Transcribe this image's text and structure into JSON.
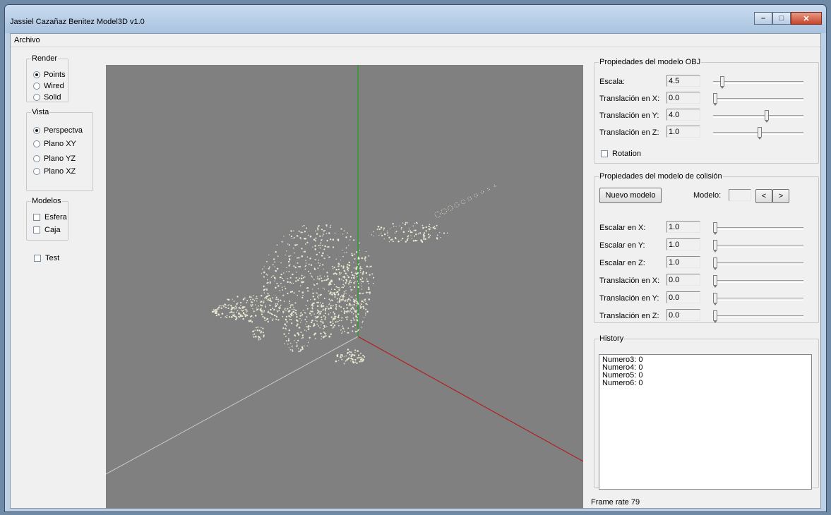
{
  "window": {
    "title": "Jassiel Cazañaz Benitez Model3D v1.0",
    "buttons": {
      "minimize": "–",
      "maximize": "□",
      "close": "✕"
    }
  },
  "menu": {
    "items": [
      "Archivo"
    ]
  },
  "render": {
    "legend": "Render",
    "options": [
      {
        "label": "Points",
        "selected": true
      },
      {
        "label": "Wired",
        "selected": false
      },
      {
        "label": "Solid",
        "selected": false
      }
    ]
  },
  "vista": {
    "legend": "Vista",
    "options": [
      {
        "label": "Perspectva",
        "selected": true
      },
      {
        "label": "Plano XY",
        "selected": false
      },
      {
        "label": "Plano YZ",
        "selected": false
      },
      {
        "label": "Plano XZ",
        "selected": false
      }
    ]
  },
  "modelos": {
    "legend": "Modelos",
    "options": [
      {
        "label": "Esfera",
        "checked": false
      },
      {
        "label": "Caja",
        "checked": false
      }
    ]
  },
  "test": {
    "label": "Test",
    "checked": false
  },
  "viewport": {
    "background": "#808080",
    "axis_colors": {
      "x": "#b02020",
      "y": "#20a020",
      "z": "#c8c8c8"
    },
    "render_mode": "points",
    "point_color": "#e8e8d2"
  },
  "obj_props": {
    "legend": "Propiedades del modelo OBJ",
    "rows": [
      {
        "label": "Escala:",
        "value": "4.5",
        "slider": 0.08
      },
      {
        "label": "Translación en X:",
        "value": "0.0",
        "slider": 0.0
      },
      {
        "label": "Translación en Y:",
        "value": "4.0",
        "slider": 0.6
      },
      {
        "label": "Translación en Z:",
        "value": "1.0",
        "slider": 0.52
      }
    ],
    "rotation": {
      "label": "Rotation",
      "checked": false
    }
  },
  "collision_props": {
    "legend": "Propiedades del modelo de colisión",
    "new_model_label": "Nuevo modelo",
    "model_label": "Modelo:",
    "model_value": "",
    "prev_label": "<",
    "next_label": ">",
    "rows": [
      {
        "label": "Escalar en X:",
        "value": "1.0",
        "slider": 0.0
      },
      {
        "label": "Escalar en Y:",
        "value": "1.0",
        "slider": 0.0
      },
      {
        "label": "Escalar en Z:",
        "value": "1.0",
        "slider": 0.0
      },
      {
        "label": "Translación en X:",
        "value": "0.0",
        "slider": 0.0
      },
      {
        "label": "Translación en Y:",
        "value": "0.0",
        "slider": 0.0
      },
      {
        "label": "Translación en Z:",
        "value": "0.0",
        "slider": 0.0
      }
    ]
  },
  "history": {
    "legend": "History",
    "items": [
      "Numero3: 0",
      "Numero4: 0",
      "Numero5: 0",
      "Numero6: 0"
    ]
  },
  "status": {
    "frame_rate": "Frame rate 79"
  }
}
